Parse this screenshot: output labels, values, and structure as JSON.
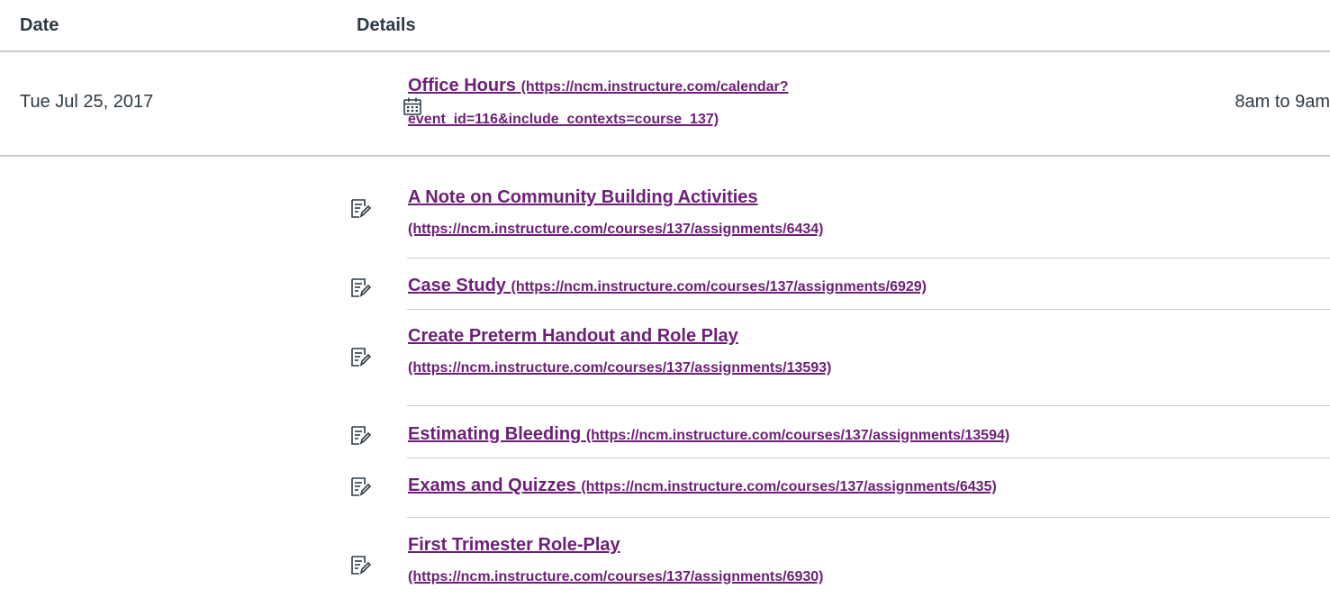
{
  "table": {
    "headers": {
      "date": "Date",
      "details": "Details"
    }
  },
  "event": {
    "date": "Tue Jul 25, 2017",
    "title": "Office Hours",
    "url": "(https://ncm.instructure.com/calendar?event_id=116&include_contexts=course_137)",
    "time": "8am to 9am",
    "icon": "calendar-icon"
  },
  "assignments": [
    {
      "title": "A Note on Community Building Activities",
      "url": "(https://ncm.instructure.com/courses/137/assignments/6434)",
      "icon": "assignment-icon"
    },
    {
      "title": "Case Study",
      "url": "(https://ncm.instructure.com/courses/137/assignments/6929)",
      "icon": "assignment-icon"
    },
    {
      "title": "Create Preterm Handout and Role Play",
      "url": "(https://ncm.instructure.com/courses/137/assignments/13593)",
      "icon": "assignment-icon"
    },
    {
      "title": "Estimating Bleeding",
      "url": "(https://ncm.instructure.com/courses/137/assignments/13594)",
      "icon": "assignment-icon"
    },
    {
      "title": "Exams and Quizzes",
      "url": "(https://ncm.instructure.com/courses/137/assignments/6435)",
      "icon": "assignment-icon"
    },
    {
      "title": "First Trimester Role-Play",
      "url": "(https://ncm.instructure.com/courses/137/assignments/6930)",
      "icon": "assignment-icon"
    }
  ],
  "colors": {
    "link": "#6d2077",
    "text": "#2d3b45",
    "border": "#c7cdd1"
  }
}
